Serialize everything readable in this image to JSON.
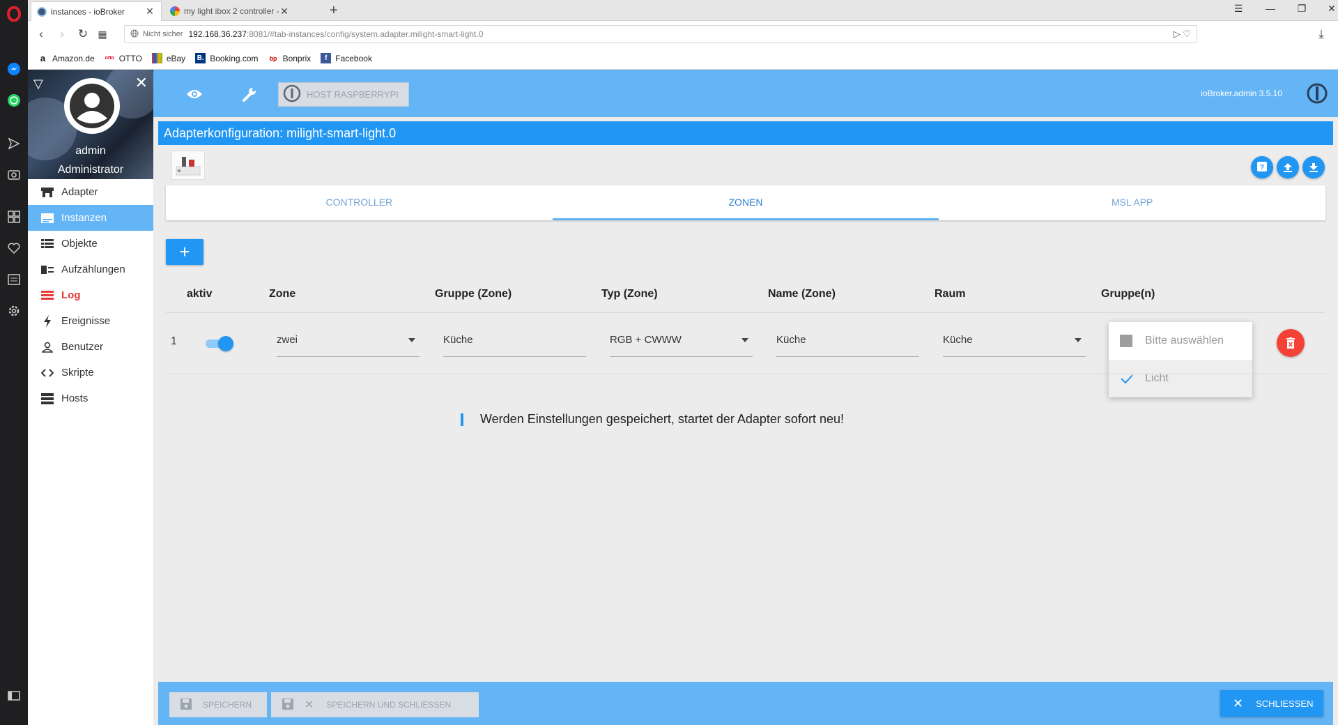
{
  "browser": {
    "tabs": [
      {
        "title": "instances - ioBroker"
      },
      {
        "title": "my light ibox 2 controller - "
      }
    ],
    "address": {
      "secure_label": "Nicht sicher",
      "url_host": "192.168.36.237",
      "url_rest": ":8081/#tab-instances/config/system.adapter.milight-smart-light.0"
    },
    "bookmarks": [
      {
        "label": "Amazon.de",
        "icon_text": "a",
        "color": "#111111"
      },
      {
        "label": "OTTO",
        "icon_text": "otto",
        "color": "#e4002b"
      },
      {
        "label": "eBay",
        "icon_text": "e",
        "color": "#333333"
      },
      {
        "label": "Booking.com",
        "icon_text": "B.",
        "color": "#003580"
      },
      {
        "label": "Bonprix",
        "icon_text": "bp",
        "color": "#cc0000"
      },
      {
        "label": "Facebook",
        "icon_text": "f",
        "color": "#3b5998"
      }
    ]
  },
  "sidebar": {
    "user_name": "admin",
    "user_role": "Administrator",
    "items": [
      {
        "label": "Adapter",
        "icon": "store-icon"
      },
      {
        "label": "Instanzen",
        "icon": "instances-icon"
      },
      {
        "label": "Objekte",
        "icon": "list-icon"
      },
      {
        "label": "Aufzählungen",
        "icon": "enum-icon"
      },
      {
        "label": "Log",
        "icon": "log-icon"
      },
      {
        "label": "Ereignisse",
        "icon": "flash-icon"
      },
      {
        "label": "Benutzer",
        "icon": "user-icon"
      },
      {
        "label": "Skripte",
        "icon": "code-icon"
      },
      {
        "label": "Hosts",
        "icon": "server-icon"
      }
    ]
  },
  "topbar": {
    "host_label": "HOST RASPBERRYPI",
    "version": "ioBroker.admin 3.5.10"
  },
  "config": {
    "title": "Adapterkonfiguration: milight-smart-light.0",
    "tabs": [
      "CONTROLLER",
      "ZONEN",
      "MSL APP"
    ],
    "add_label": "+",
    "columns": [
      "aktiv",
      "Zone",
      "Gruppe (Zone)",
      "Typ (Zone)",
      "Name (Zone)",
      "Raum",
      "Gruppe(n)"
    ],
    "row": {
      "index": "1",
      "active": true,
      "zone": "zwei",
      "group_zone": "Küche",
      "type_zone": "RGB + CWWW",
      "name_zone": "Küche",
      "room": "Küche"
    },
    "groups_dropdown": [
      {
        "label": "Bitte auswählen",
        "state": "none"
      },
      {
        "label": "Licht",
        "state": "checked"
      }
    ],
    "info_text": "Werden Einstellungen gespeichert, startet der Adapter sofort neu!"
  },
  "bottombar": {
    "save_label": "SPEICHERN",
    "save_close_label": "SPEICHERN UND SCHLIESSEN",
    "close_label": "SCHLIESSEN"
  },
  "colors": {
    "primary": "#2196f3",
    "toolbar": "#64b5f6",
    "danger": "#f44336",
    "log": "#e53935"
  }
}
